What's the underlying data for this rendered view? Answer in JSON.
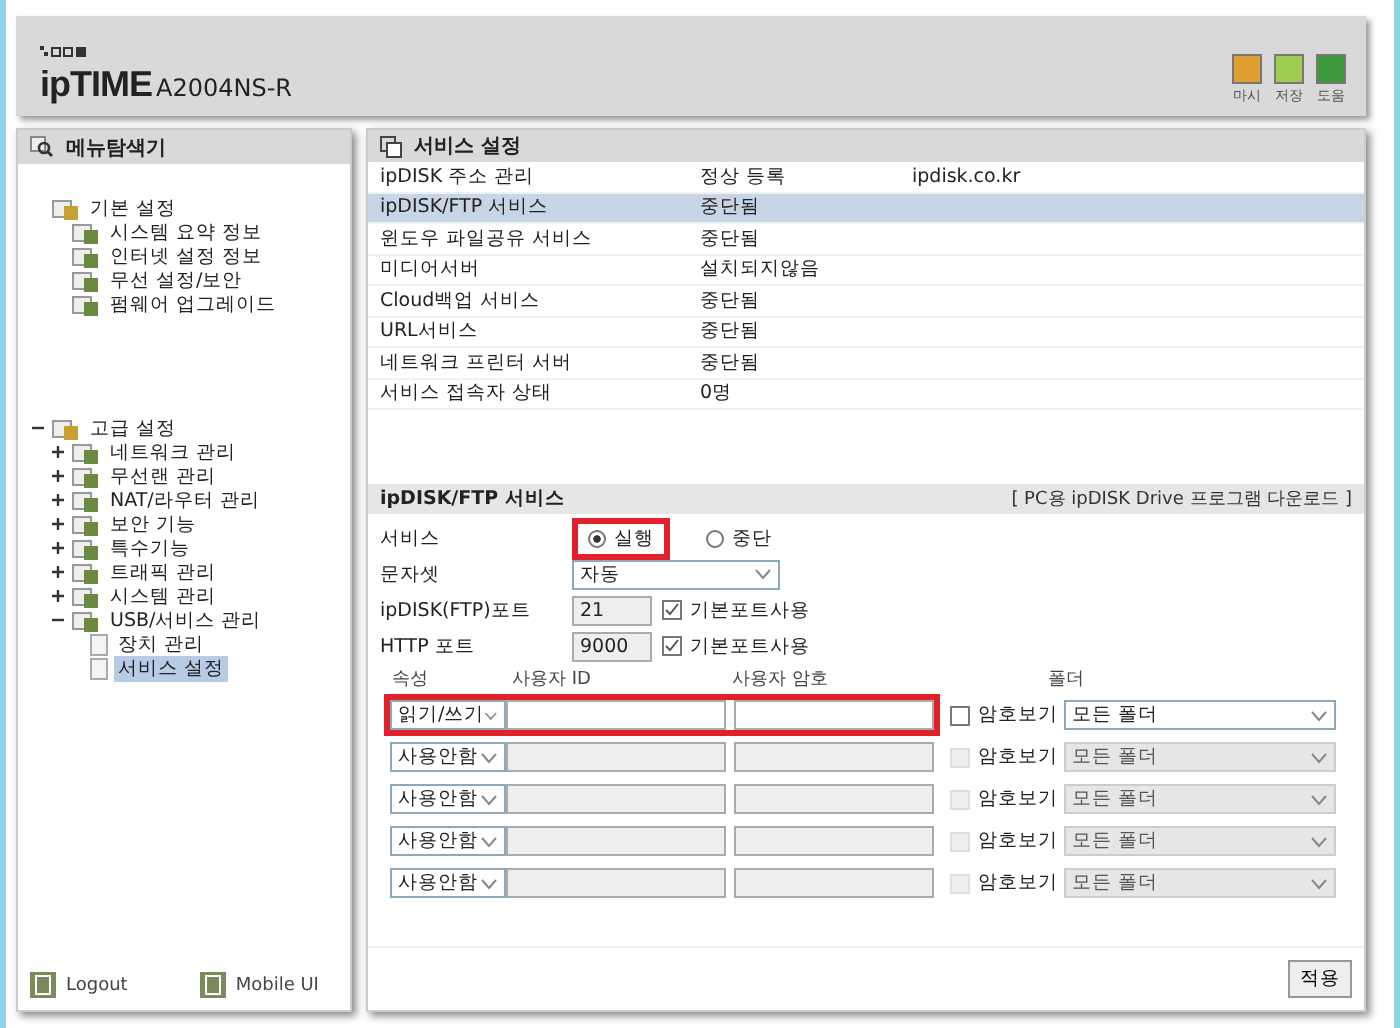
{
  "header": {
    "logo": "ipTIME",
    "model": "A2004NS-R",
    "tools": [
      {
        "label": "마시",
        "color": "#e0a030"
      },
      {
        "label": "저장",
        "color": "#9ccc50"
      },
      {
        "label": "도움",
        "color": "#3d9a3d"
      }
    ]
  },
  "sidebar": {
    "title": "메뉴탐색기",
    "groups": [
      {
        "label": "기본 설정",
        "children": [
          {
            "label": "시스템 요약 정보",
            "selected": false
          },
          {
            "label": "인터넷 설정 정보",
            "selected": false
          },
          {
            "label": "무선 설정/보안",
            "selected": false
          },
          {
            "label": "펌웨어 업그레이드",
            "selected": false
          }
        ]
      },
      {
        "label": "고급 설정",
        "expanded": true,
        "children": [
          {
            "label": "네트워크 관리",
            "expanded": false,
            "selected": false
          },
          {
            "label": "무선랜 관리",
            "expanded": false,
            "selected": false
          },
          {
            "label": "NAT/라우터 관리",
            "expanded": false,
            "selected": false
          },
          {
            "label": "보안 기능",
            "expanded": false,
            "selected": false
          },
          {
            "label": "특수기능",
            "expanded": false,
            "selected": false
          },
          {
            "label": "트래픽 관리",
            "expanded": false,
            "selected": false
          },
          {
            "label": "시스템 관리",
            "expanded": false,
            "selected": false
          },
          {
            "label": "USB/서비스 관리",
            "expanded": true,
            "selected": false,
            "children": [
              {
                "label": "장치 관리",
                "selected": false
              },
              {
                "label": "서비스 설정",
                "selected": true
              }
            ]
          }
        ]
      }
    ],
    "footer": [
      {
        "label": "Logout"
      },
      {
        "label": "Mobile UI"
      }
    ]
  },
  "panel": {
    "title": "서비스 설정",
    "services": [
      {
        "name": "ipDISK 주소 관리",
        "status": "정상 등록",
        "address": "ipdisk.co.kr",
        "selected": false
      },
      {
        "name": "ipDISK/FTP 서비스",
        "status": "중단됨",
        "selected": true
      },
      {
        "name": "윈도우 파일공유 서비스",
        "status": "중단됨",
        "selected": false
      },
      {
        "name": "미디어서버",
        "status": "설치되지않음",
        "selected": false
      },
      {
        "name": "Cloud백업 서비스",
        "status": "중단됨",
        "selected": false
      },
      {
        "name": "URL서비스",
        "status": "중단됨",
        "selected": false
      },
      {
        "name": "네트워크 프린터 서버",
        "status": "중단됨",
        "selected": false
      },
      {
        "name": "서비스 접속자 상태",
        "status": "0명",
        "selected": false
      }
    ],
    "section": {
      "title": "ipDISK/FTP 서비스",
      "download_link": "[ PC용 ipDISK Drive 프로그램 다운로드 ]",
      "service": {
        "label": "서비스",
        "options": [
          {
            "label": "실행",
            "selected": true,
            "highlighted": true
          },
          {
            "label": "중단",
            "selected": false,
            "highlighted": false
          }
        ]
      },
      "charset": {
        "label": "문자셋",
        "value": "자동"
      },
      "ports": [
        {
          "label": "ipDISK(FTP)포트",
          "value": "21",
          "checkbox_label": "기본포트사용",
          "checked": true
        },
        {
          "label": "HTTP 포트",
          "value": "9000",
          "checkbox_label": "기본포트사용",
          "checked": true
        }
      ],
      "accounts": {
        "columns": [
          "속성",
          "사용자 ID",
          "사용자 암호",
          "폴더"
        ],
        "rows": [
          {
            "attribute": "읽기/쓰기",
            "disabled": false,
            "highlighted": true,
            "show_password_label": "암호보기",
            "show_password": false,
            "folder": "모든 폴더"
          },
          {
            "attribute": "사용안함",
            "disabled": true,
            "highlighted": false,
            "show_password_label": "암호보기",
            "show_password": false,
            "folder": "모든 폴더"
          },
          {
            "attribute": "사용안함",
            "disabled": true,
            "highlighted": false,
            "show_password_label": "암호보기",
            "show_password": false,
            "folder": "모든 폴더"
          },
          {
            "attribute": "사용안함",
            "disabled": true,
            "highlighted": false,
            "show_password_label": "암호보기",
            "show_password": false,
            "folder": "모든 폴더"
          },
          {
            "attribute": "사용안함",
            "disabled": true,
            "highlighted": false,
            "show_password_label": "암호보기",
            "show_password": false,
            "folder": "모든 폴더"
          }
        ]
      },
      "apply": "적용"
    }
  }
}
